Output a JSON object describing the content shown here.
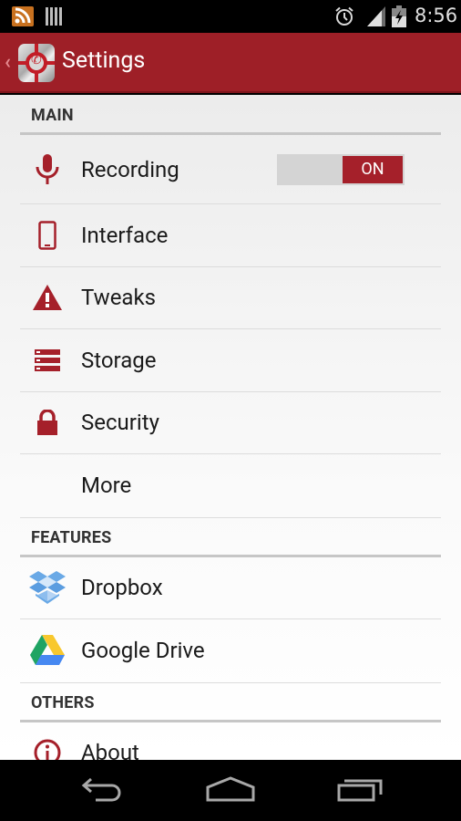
{
  "status_bar": {
    "time": "8:56",
    "icons": [
      "rss-icon",
      "barcode-icon",
      "alarm-icon",
      "signal-icon",
      "battery-charging-icon"
    ]
  },
  "action_bar": {
    "title": "Settings",
    "up_icon": "chevron-left-icon",
    "app_icon": "call-recorder-app-icon"
  },
  "colors": {
    "accent": "#9e1f27",
    "toggle_on": "#a5202a",
    "toggle_track": "#d4d4d4"
  },
  "sections": [
    {
      "header": "MAIN",
      "items": [
        {
          "label": "Recording",
          "icon": "microphone-icon",
          "toggle": {
            "state": "ON",
            "on": true
          }
        },
        {
          "label": "Interface",
          "icon": "phone-device-icon"
        },
        {
          "label": "Tweaks",
          "icon": "warning-icon"
        },
        {
          "label": "Storage",
          "icon": "storage-icon"
        },
        {
          "label": "Security",
          "icon": "lock-icon"
        },
        {
          "label": "More",
          "icon": ""
        }
      ]
    },
    {
      "header": "FEATURES",
      "items": [
        {
          "label": "Dropbox",
          "icon": "dropbox-icon"
        },
        {
          "label": "Google Drive",
          "icon": "google-drive-icon"
        }
      ]
    },
    {
      "header": "OTHERS",
      "items": [
        {
          "label": "About",
          "icon": "info-icon"
        }
      ]
    }
  ],
  "nav_bar": {
    "buttons": [
      "back-icon",
      "home-icon",
      "recents-icon"
    ]
  }
}
